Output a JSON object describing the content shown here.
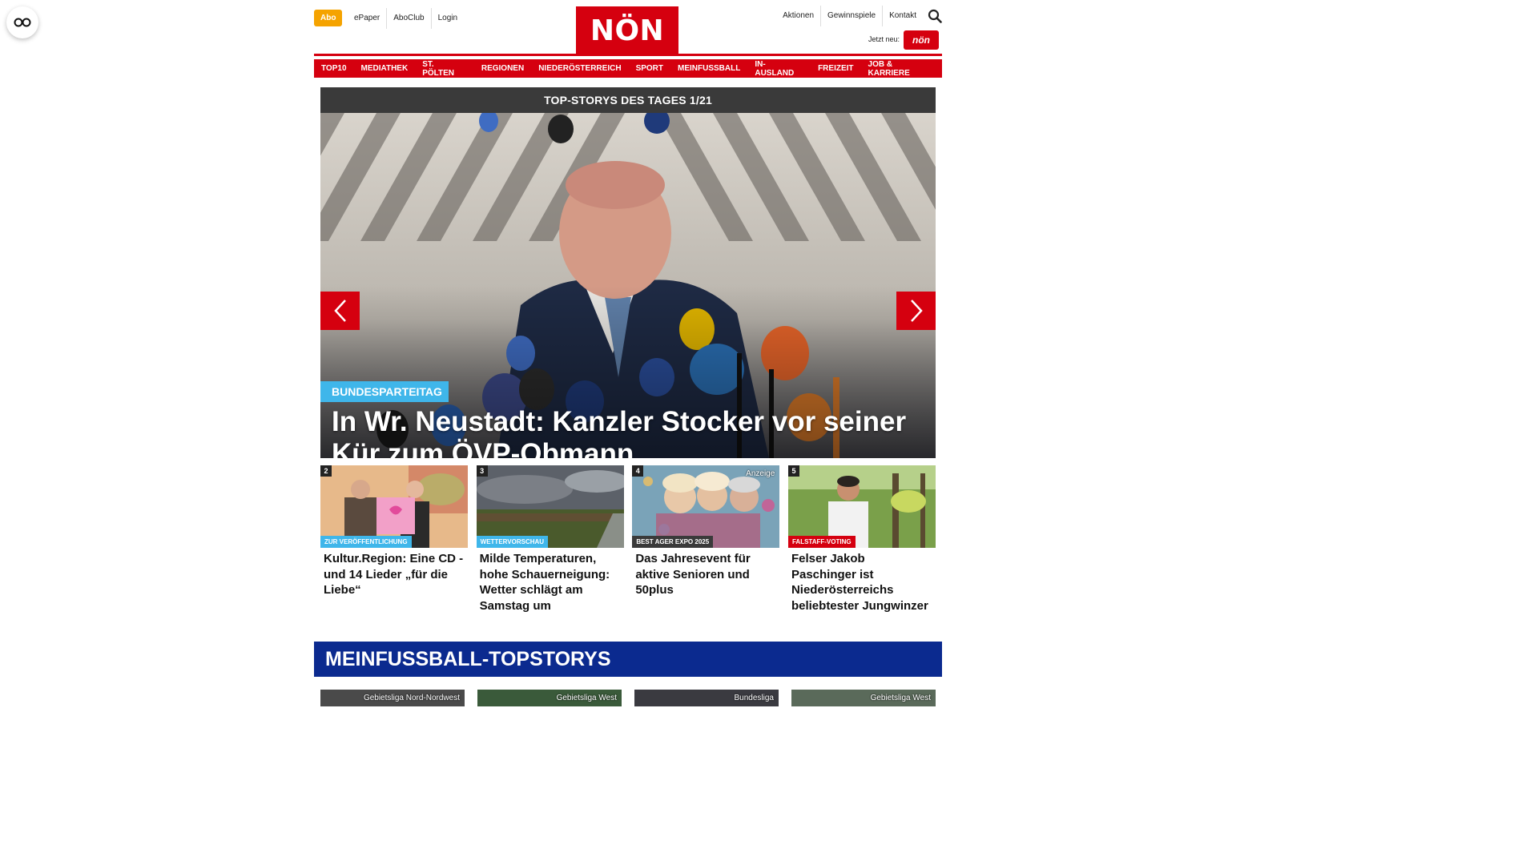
{
  "reader_icon": "glasses-icon",
  "header": {
    "abo": "Abo",
    "left_links": [
      "ePaper",
      "AboClub",
      "Login"
    ],
    "right_links": [
      "Aktionen",
      "Gewinnspiele",
      "Kontakt"
    ],
    "logo_text": "NÖN",
    "jetzt_neu": "Jetzt neu:",
    "app_badge": "nön",
    "search_icon": "search-icon"
  },
  "nav": [
    "TOP10",
    "MEDIATHEK",
    "ST. PÖLTEN",
    "REGIONEN",
    "NIEDERÖSTERREICH",
    "SPORT",
    "MEINFUSSBALL",
    "IN-AUSLAND",
    "FREIZEIT",
    "JOB & KARRIERE"
  ],
  "slider": {
    "title": "TOP-STORYS DES TAGES 1/21",
    "kicker": "BUNDESPARTEITAG",
    "headline": "In Wr. Neustadt: Kanzler Stocker vor seiner Kür zum ÖVP-Obmann"
  },
  "teasers": [
    {
      "num": "2",
      "tag": "ZUR VERÖFFENTLICHUNG",
      "tag_color": "#3fb6ea",
      "title": "Kultur.Region: Eine CD - und 14 Lieder „für die Liebe“",
      "ad": ""
    },
    {
      "num": "3",
      "tag": "WETTERVORSCHAU",
      "tag_color": "#3fb6ea",
      "title": "Milde Temperaturen, hohe Schauerneigung: Wetter schlägt am Samstag um",
      "ad": ""
    },
    {
      "num": "4",
      "tag": "BEST AGER EXPO 2025",
      "tag_color": "#3a3a3a",
      "title": "Das Jahresevent für aktive Senioren und 50plus",
      "ad": "Anzeige"
    },
    {
      "num": "5",
      "tag": "FALSTAFF-VOTING",
      "tag_color": "#d5000f",
      "title": "Felser Jakob Paschinger ist Niederösterreichs beliebtester Jungwinzer",
      "ad": ""
    }
  ],
  "section": {
    "title": "MEINFUSSBALL-TOPSTORYS",
    "cards": [
      "Gebietsliga Nord-Nordwest",
      "Gebietsliga West",
      "Bundesliga",
      "Gebietsliga West"
    ]
  },
  "colors": {
    "brand_red": "#d5000f",
    "abo_orange": "#f5a300",
    "kicker_blue": "#3fb6ea",
    "section_blue": "#0b2a8f"
  }
}
